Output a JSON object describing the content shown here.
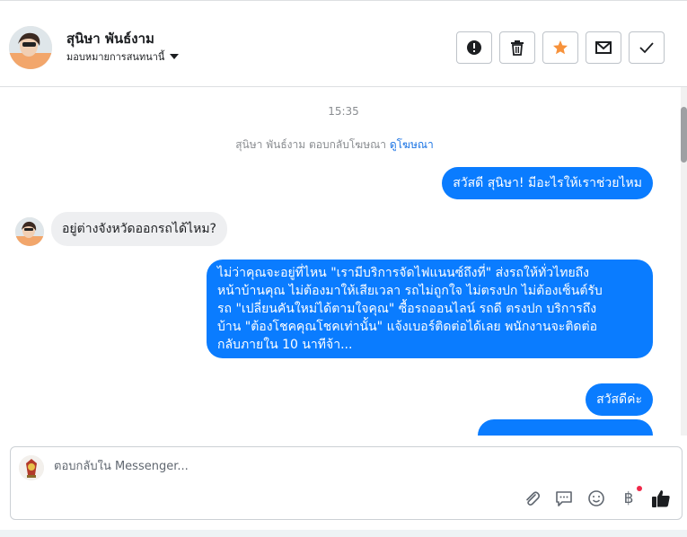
{
  "header": {
    "contact_name": "สุนิษา พันธ์งาม",
    "assign_label": "มอบหมายการสนทนานี้",
    "actions": [
      {
        "name": "spam-button",
        "icon": "exclamation-circle-icon"
      },
      {
        "name": "delete-button",
        "icon": "trash-icon"
      },
      {
        "name": "star-button",
        "icon": "star-icon",
        "color": "#f7923b"
      },
      {
        "name": "mark-unread-button",
        "icon": "envelope-icon"
      },
      {
        "name": "mark-done-button",
        "icon": "checkmark-icon"
      }
    ]
  },
  "chat": {
    "timestamp": "15:35",
    "ad_notice_prefix": "สุนิษา พันธ์งาม ตอบกลับโฆษณา",
    "ad_notice_link": "ดูโฆษณา",
    "messages": [
      {
        "direction": "out",
        "text": "สวัสดี สุนิษา! มีอะไรให้เราช่วยไหม"
      },
      {
        "direction": "in",
        "text": "อยู่ต่างจังหวัดออกรถได้ไหม?"
      },
      {
        "direction": "out",
        "lines": [
          "ไม่ว่าคุณจะอยู่ที่ไหน \"เรามีบริการจัดไฟแนนซ์ถึงที่\"  ส่งรถให้ทั่วไทยถึง",
          "หน้าบ้านคุณ ไม่ต้องมาให้เสียเวลา รถไม่ถูกใจ ไม่ตรงปก ไม่ต้องเซ็นต์รับ",
          "รถ \"เปลี่ยนคันใหม่ได้ตามใจคุณ\" ซื้อรถออนไลน์ รถดี ตรงปก บริการถึง",
          "บ้าน \"ต้องโชคคุณโชคเท่านั้น\" แจ้งเบอร์ติดต่อได้เลย พนักงานจะติดต่อ",
          "กลับภายใน 10 นาทีจ้า..."
        ]
      },
      {
        "direction": "out",
        "text": "สวัสดีค่ะ"
      }
    ]
  },
  "composer": {
    "placeholder": "ตอบกลับใน Messenger...",
    "tools": [
      "paperclip-icon",
      "saved-replies-icon",
      "emoji-icon",
      "baht-payment-icon",
      "thumbs-up-icon"
    ],
    "baht_symbol": "฿",
    "accent": "#0a7cff"
  }
}
